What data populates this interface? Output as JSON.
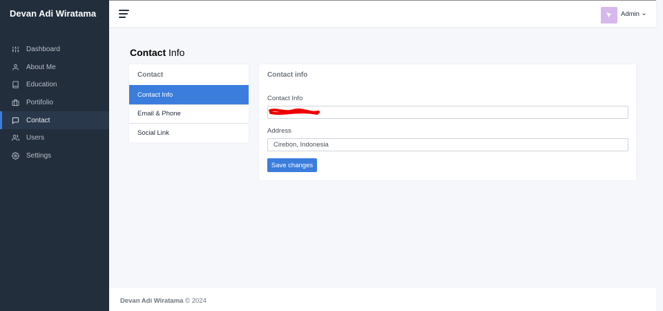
{
  "brand": "Devan Adi Wiratama",
  "sidebar": {
    "items": [
      {
        "label": "Dashboard",
        "icon": "sliders-icon"
      },
      {
        "label": "About Me",
        "icon": "user-icon"
      },
      {
        "label": "Education",
        "icon": "book-icon"
      },
      {
        "label": "Portifolio",
        "icon": "briefcase-icon"
      },
      {
        "label": "Contact",
        "icon": "message-square-icon",
        "active": true
      },
      {
        "label": "Users",
        "icon": "users-icon"
      },
      {
        "label": "Settings",
        "icon": "gear-icon"
      }
    ]
  },
  "header": {
    "user_name": "Admin",
    "avatar_color": "#d7b8ec"
  },
  "page": {
    "title_bold": "Contact",
    "title_rest": " Info"
  },
  "contact_menu": {
    "heading": "Contact",
    "items": [
      "Contact Info",
      "Email & Phone",
      "Social Link"
    ],
    "active_index": 0
  },
  "form": {
    "heading": "Contact info",
    "contact_info_label": "Contact Info",
    "contact_info_value": "",
    "address_label": "Address",
    "address_value": "Cirebon, Indonesia",
    "save_label": "Save changes"
  },
  "footer": {
    "name": "Devan Adi Wiratama",
    "suffix": " © 2024"
  },
  "colors": {
    "sidebar_bg": "#222e3c",
    "accent": "#3b7ddd",
    "redaction": "#ee0000"
  }
}
